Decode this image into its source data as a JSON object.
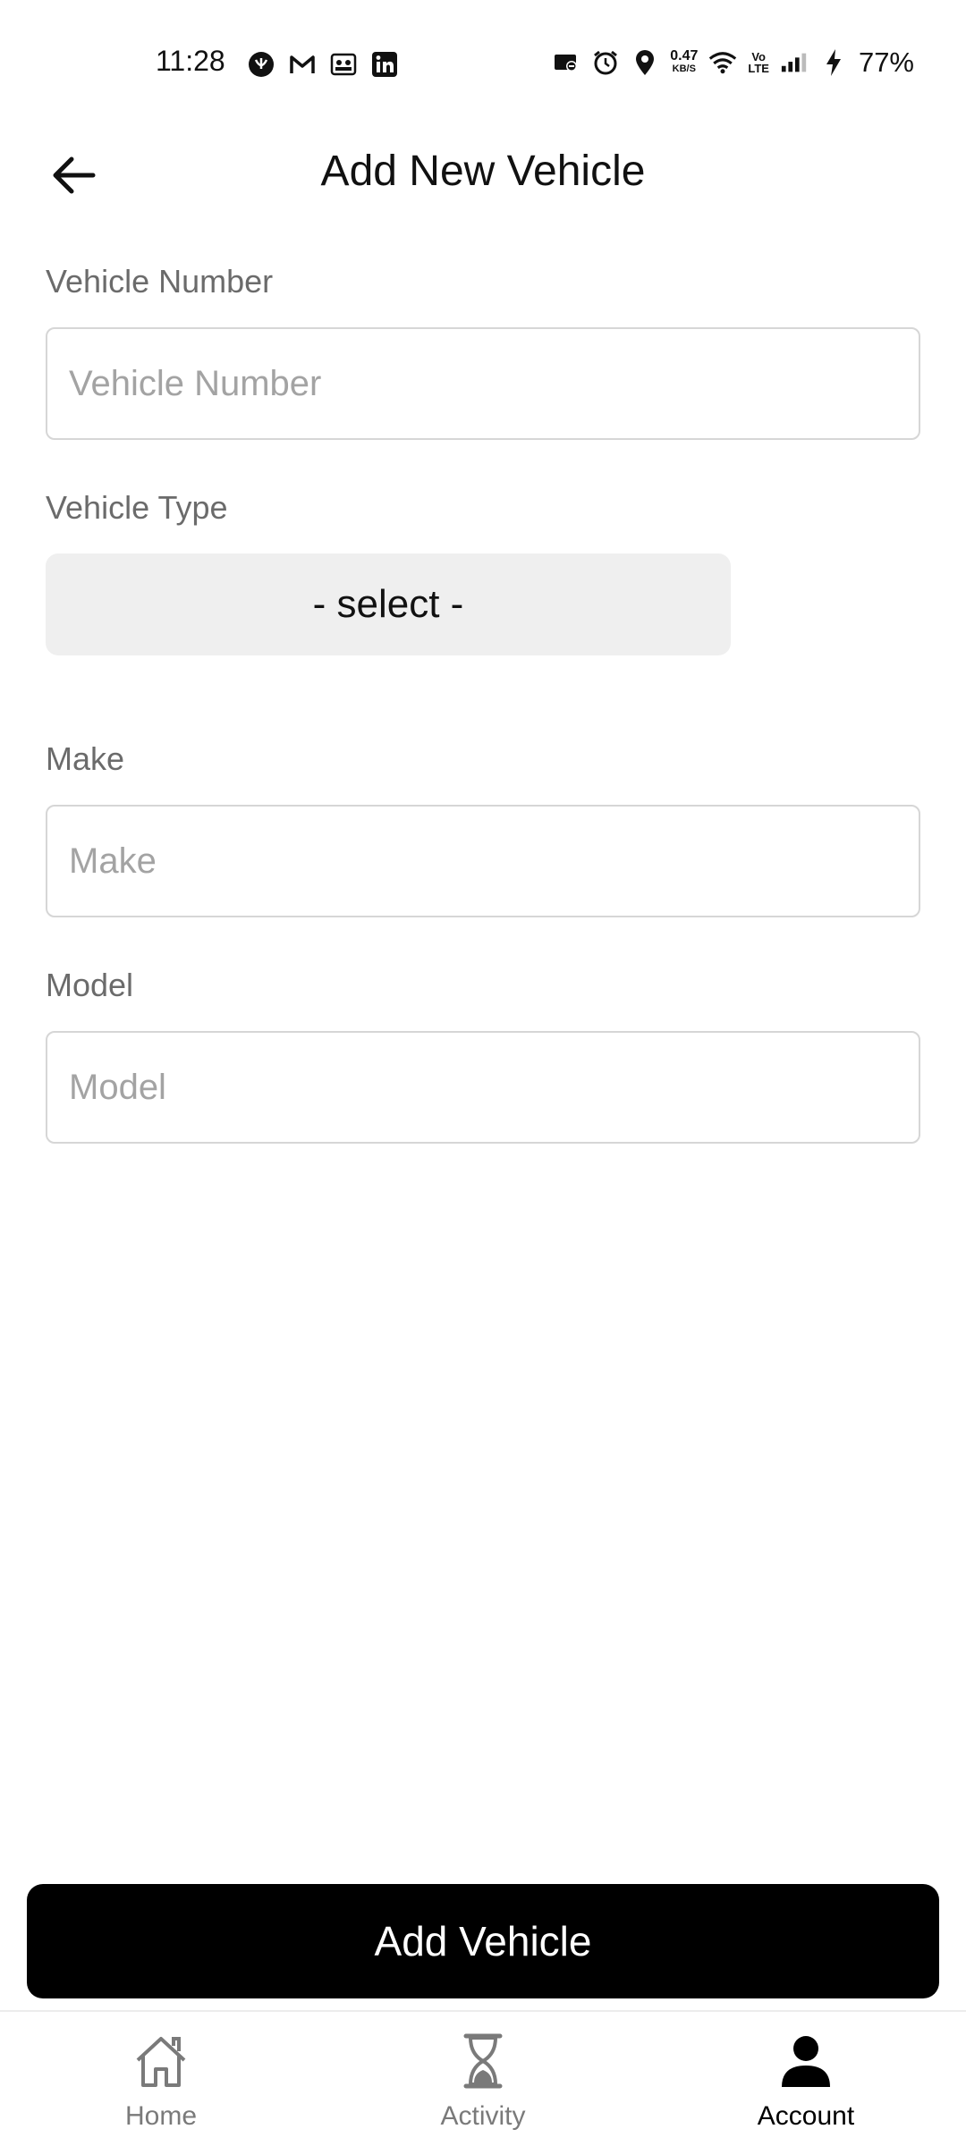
{
  "status_bar": {
    "time": "11:28",
    "left_icons": [
      "app-notification-icon",
      "gmail-icon",
      "meetup-icon",
      "linkedin-icon"
    ],
    "right_icons": [
      "screen-cast-icon",
      "alarm-icon",
      "location-icon",
      "wifi-icon",
      "signal-icon",
      "charging-icon"
    ],
    "net_speed": "0.47",
    "net_speed_unit": "KB/S",
    "volte_top": "Vo",
    "volte_bottom": "LTE",
    "battery": "77%"
  },
  "header": {
    "title": "Add New Vehicle",
    "back_icon": "arrow-left-icon"
  },
  "form": {
    "vehicle_number": {
      "label": "Vehicle Number",
      "placeholder": "Vehicle Number",
      "value": ""
    },
    "vehicle_type": {
      "label": "Vehicle Type",
      "selected": "- select -"
    },
    "make": {
      "label": "Make",
      "placeholder": "Make",
      "value": ""
    },
    "model": {
      "label": "Model",
      "placeholder": "Model",
      "value": ""
    }
  },
  "actions": {
    "add_vehicle_label": "Add Vehicle"
  },
  "bottom_nav": {
    "items": [
      {
        "label": "Home",
        "icon": "home-icon",
        "active": false
      },
      {
        "label": "Activity",
        "icon": "hourglass-icon",
        "active": false
      },
      {
        "label": "Account",
        "icon": "person-icon",
        "active": true
      }
    ]
  },
  "colors": {
    "primary_button": "#000000",
    "select_background": "#efefef",
    "input_border": "#d6d6d6",
    "label_text": "#6b6b6b",
    "placeholder_text": "#a3a3a3",
    "nav_inactive": "#7a7a7a"
  }
}
